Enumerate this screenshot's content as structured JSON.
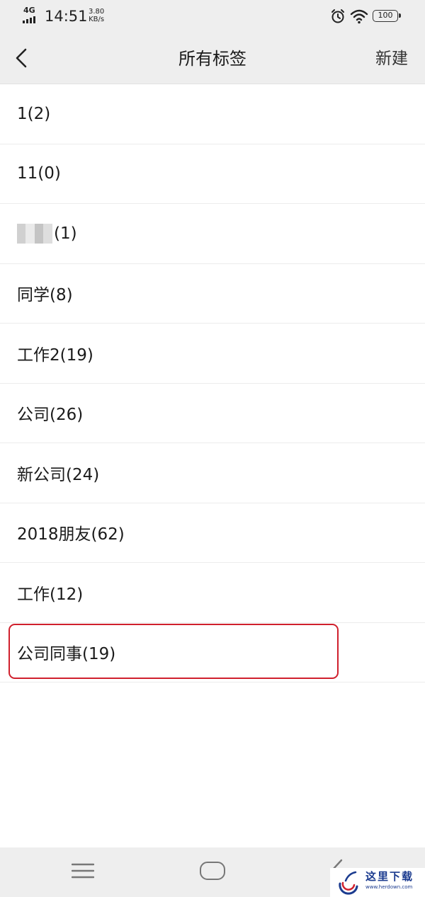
{
  "status_bar": {
    "network": "4G",
    "time": "14:51",
    "speed_value": "3.80",
    "speed_unit": "KB/s",
    "battery": "100"
  },
  "nav": {
    "title": "所有标签",
    "action_label": "新建"
  },
  "tags": [
    {
      "label": "1(2)"
    },
    {
      "label": "11(0)"
    },
    {
      "label": "(1)",
      "pixelated_prefix": true
    },
    {
      "label": "同学(8)"
    },
    {
      "label": "工作2(19)"
    },
    {
      "label": "公司(26)"
    },
    {
      "label": "新公司(24)"
    },
    {
      "label": "2018朋友(62)"
    },
    {
      "label": "工作(12)"
    },
    {
      "label": "公司同事(19)",
      "highlighted": true
    }
  ],
  "colors": {
    "highlight_border": "#d0202d",
    "bar_background": "#eeeeee"
  },
  "watermark": {
    "text": "这里下载",
    "url": "www.herdown.com"
  }
}
